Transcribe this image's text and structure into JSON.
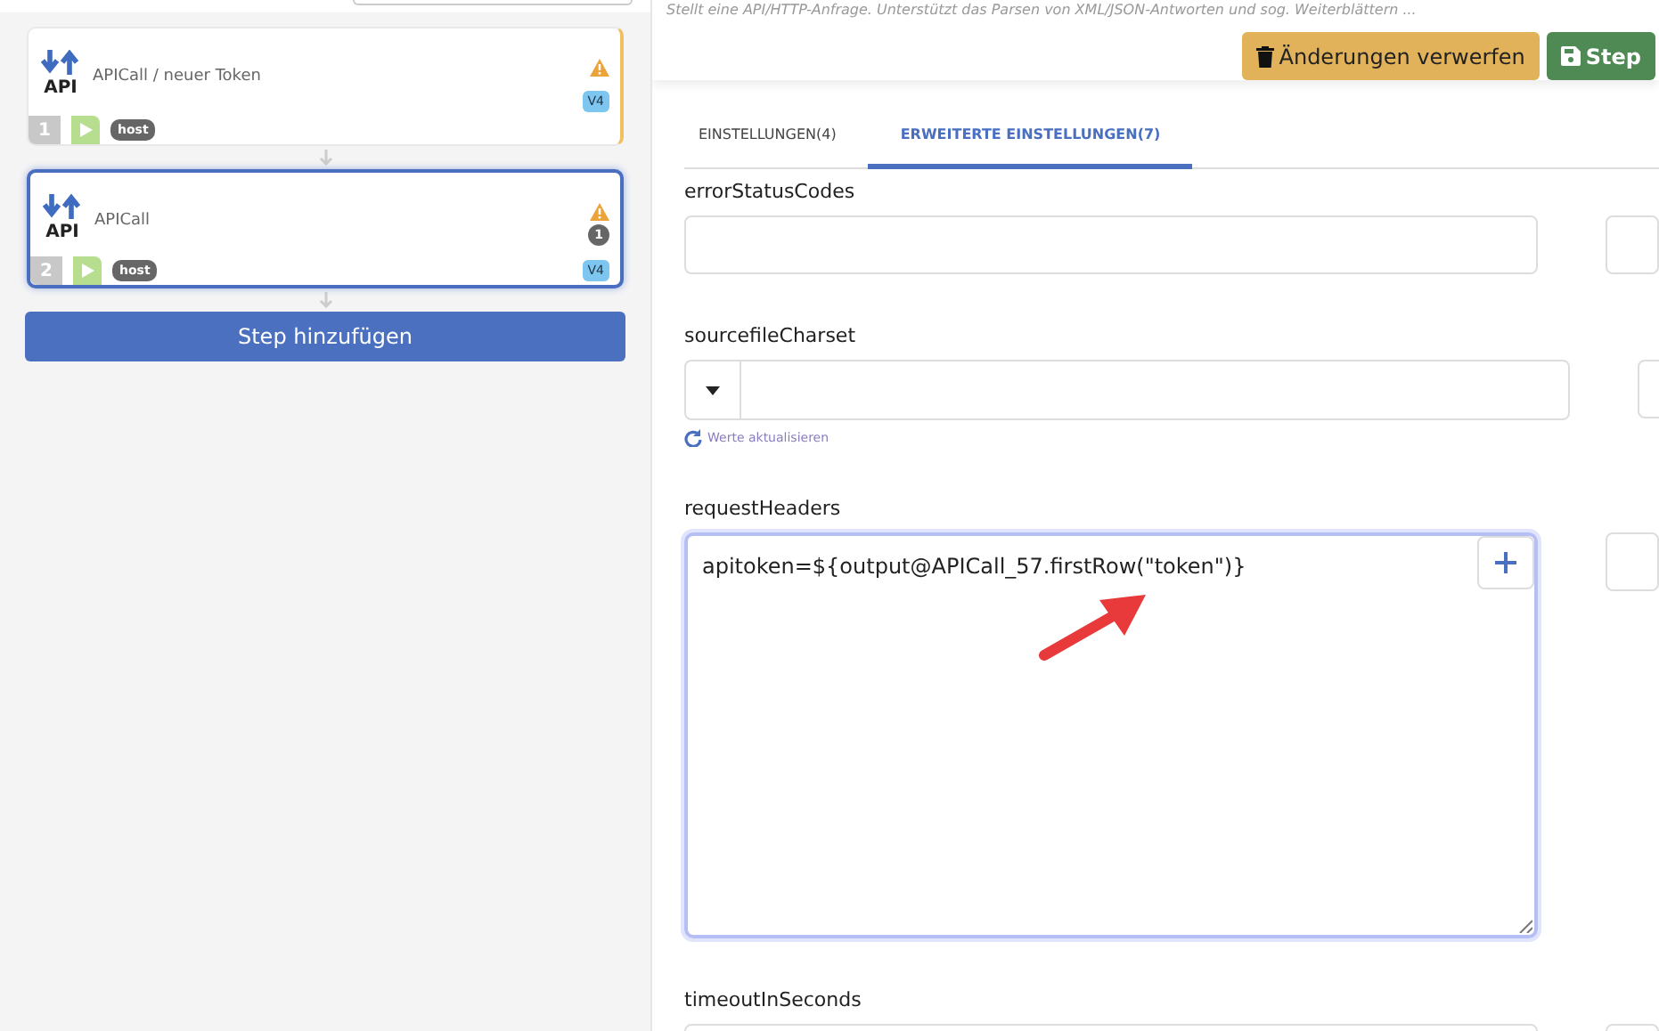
{
  "description": "Stellt eine API/HTTP-Anfrage. Unterstützt das Parsen von XML/JSON-Antworten und sog. Weiterblättern ...",
  "steps": [
    {
      "icon_label": "API",
      "title": "APICall / neuer Token",
      "number": "1",
      "tag": "host",
      "version": "V4",
      "warning": true,
      "selected": false
    },
    {
      "icon_label": "API",
      "title": "APICall",
      "number": "2",
      "tag": "host",
      "version": "V4",
      "warning": true,
      "count": "1",
      "selected": true
    }
  ],
  "add_step_button": "Step hinzufügen",
  "actions": [
    {
      "kind": "discard",
      "label": "Änderungen verwerfen"
    },
    {
      "kind": "save",
      "label": "Step"
    }
  ],
  "tabs": [
    {
      "label": "EINSTELLUNGEN(4)",
      "selected": false
    },
    {
      "label": "ERWEITERTE EINSTELLUNGEN(7)",
      "selected": true
    }
  ],
  "fields": [
    {
      "kind": "text",
      "label": "errorStatusCodes"
    },
    {
      "kind": "select",
      "label": "sourcefileCharset",
      "refresh_link": "Werte aktualisieren"
    },
    {
      "kind": "textarea",
      "label": "requestHeaders",
      "value": "apitoken=${output@APICall_57.firstRow(\"token\")}",
      "focused": true
    },
    {
      "kind": "text",
      "label": "timeoutInSeconds"
    }
  ]
}
